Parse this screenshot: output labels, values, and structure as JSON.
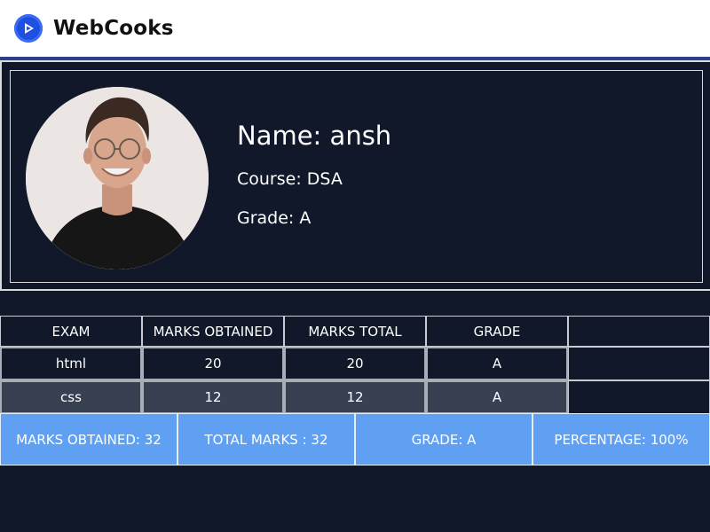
{
  "navbar": {
    "brand": "WebCooks",
    "logo_icon": "play-icon",
    "accent_color": "#1f4fe0"
  },
  "profile": {
    "name": "Name: ansh",
    "course": "Course: DSA",
    "grade": "Grade: A",
    "avatar_icon": "user-photo"
  },
  "table": {
    "headers": [
      "EXAM",
      "MARKS OBTAINED",
      "MARKS TOTAL",
      "GRADE"
    ],
    "rows": [
      [
        "html",
        "20",
        "20",
        "A"
      ],
      [
        "css",
        "12",
        "12",
        "A"
      ]
    ]
  },
  "summary": {
    "marks_obtained": "MARKS OBTAINED: 32",
    "total_marks": "TOTAL MARKS : 32",
    "grade": "GRADE: A",
    "percentage": "PERCENTAGE: 100%",
    "color": "#5fa0f2"
  },
  "colors": {
    "background": "#11182a",
    "row_alt": "#374151"
  }
}
